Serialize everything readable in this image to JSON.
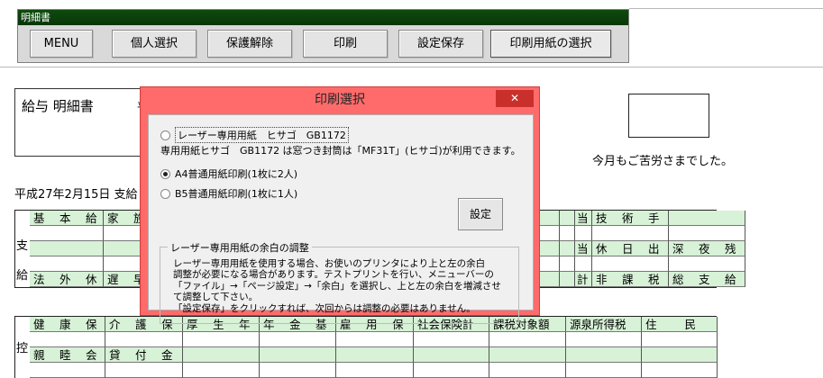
{
  "toolbar": {
    "title": "明細書",
    "buttons": [
      "MENU",
      "個人選択",
      "保護解除",
      "印刷",
      "設定保存",
      "印刷用紙の選択"
    ]
  },
  "sheet": {
    "title": "給与 明細書",
    "title_suffix": "平",
    "thanks": "今月もご苦労さまでした。",
    "pay_date": "平成27年2月15日 支給",
    "side_labels": {
      "pay_top": "支",
      "pay_bottom": "給",
      "deduct": "控"
    },
    "pay_rows": [
      [
        "基　本　給",
        "家　族",
        "",
        "",
        "",
        "",
        "",
        "",
        "当",
        "技　術　手　当",
        ""
      ],
      [
        "",
        "",
        "",
        "",
        "",
        "",
        "",
        "",
        "当",
        "休　日　出　勤",
        "深　夜　残　業"
      ],
      [
        "法　外　休　出",
        "遅　早",
        "",
        "",
        "",
        "",
        "",
        "",
        "計",
        "非　課　税　計",
        "総　支　給　額"
      ]
    ],
    "deduction_headers": [
      "健　康　保　険",
      "介　護　保　険",
      "厚　生　年　金",
      "年　金　基　金",
      "雇　用　保　険",
      "社会保険計",
      "課税対象額",
      "源泉所得税",
      "住　　民　　税"
    ],
    "deduction_row3": [
      "親　睦　会",
      "貸　付　金",
      "",
      "",
      "",
      "",
      "",
      "",
      ""
    ]
  },
  "dialog": {
    "title": "印刷選択",
    "close": "✕",
    "options": {
      "laser": "レーザー専用用紙　ヒサゴ　GB1172",
      "a4": "A4普通用紙印刷(1枚に2人)",
      "b5": "B5普通用紙印刷(1枚に1人)"
    },
    "selected_option": "a4",
    "note": "専用用紙ヒサゴ　GB1172 は窓つき封筒は「MF31T」(ヒサゴ)が利用できます。",
    "setting_button": "設定",
    "margin_group": {
      "legend": "レーザー専用用紙の余白の調整",
      "lines": [
        "レーザー専用用紙を使用する場合、お使いのプリンタにより上と左の余白",
        "調整が必要になる場合があります。テストプリントを行い、メニューバーの",
        "「ファイル」→「ページ設定」→「余白」を選択し、上と左の余白を増減させ",
        "て調整して下さい。",
        "「設定保存」をクリックすれば、次回からは調整の必要はありません。"
      ]
    }
  }
}
